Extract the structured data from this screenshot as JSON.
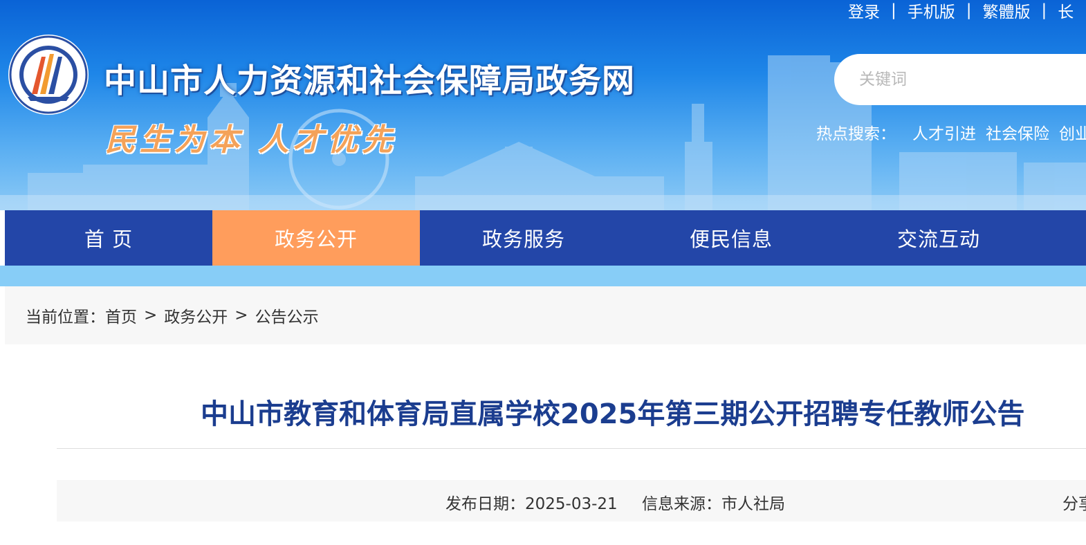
{
  "header": {
    "site_title": "中山市人力资源和社会保障局政务网",
    "slogan": "民生为本 人才优先",
    "top_links": [
      "登录",
      "手机版",
      "繁體版",
      "长"
    ],
    "search": {
      "placeholder": "关键词"
    },
    "hot_search": {
      "label": "热点搜索：",
      "items": [
        "人才引进",
        "社会保险",
        "创业"
      ]
    }
  },
  "nav": {
    "items": [
      "首 页",
      "政务公开",
      "政务服务",
      "便民信息",
      "交流互动"
    ],
    "active": "政务公开"
  },
  "breadcrumb": {
    "label": "当前位置：",
    "items": [
      "首页",
      "政务公开",
      "公告公示"
    ],
    "separator": ">"
  },
  "article": {
    "title": "中山市教育和体育局直属学校2025年第三期公开招聘专任教师公告",
    "publish_date": "发布日期：2025-03-21",
    "source": "信息来源：市人社局",
    "share": "分享"
  },
  "colors": {
    "nav_bg": "#2346a8",
    "nav_active": "#ff9d5c",
    "title": "#1b3d8f",
    "slogan": "#f4a259"
  }
}
